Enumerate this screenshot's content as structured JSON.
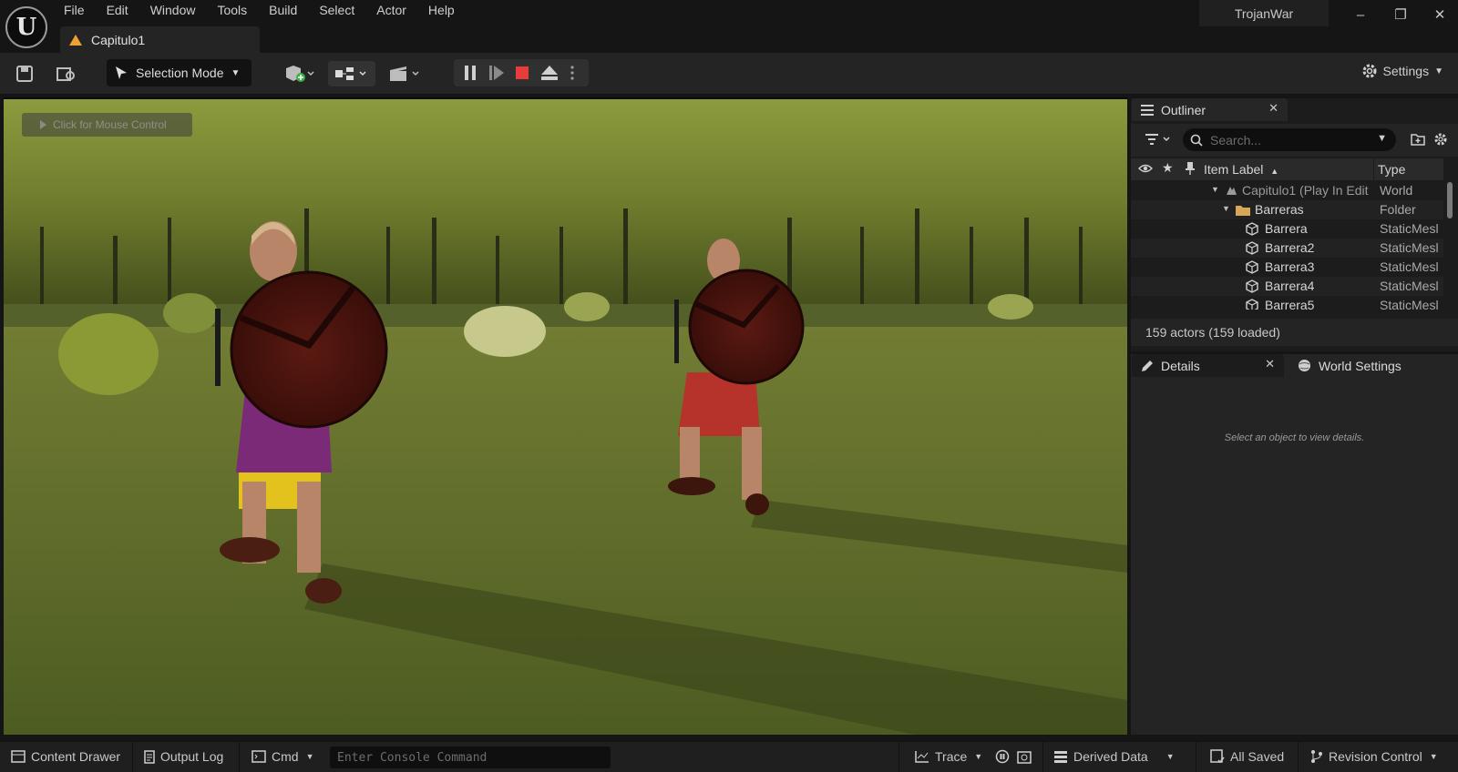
{
  "menu": [
    "File",
    "Edit",
    "Window",
    "Tools",
    "Build",
    "Select",
    "Actor",
    "Help"
  ],
  "document_tab": "Capitulo1",
  "project_name": "TrojanWar",
  "window_controls": {
    "minimize": "–",
    "restore": "❐",
    "close": "✕"
  },
  "toolbar": {
    "selection_mode": "Selection Mode",
    "settings": "Settings"
  },
  "viewport": {
    "mouse_control": "Click for Mouse Control"
  },
  "outliner": {
    "tab": "Outliner",
    "search_placeholder": "Search...",
    "columns": {
      "label": "Item Label",
      "type": "Type"
    },
    "rows": [
      {
        "label": "Capitulo1 (Play In Edit",
        "type": "World"
      },
      {
        "label": "Barreras",
        "type": "Folder"
      },
      {
        "label": "Barrera",
        "type": "StaticMesl"
      },
      {
        "label": "Barrera2",
        "type": "StaticMesl"
      },
      {
        "label": "Barrera3",
        "type": "StaticMesl"
      },
      {
        "label": "Barrera4",
        "type": "StaticMesl"
      },
      {
        "label": "Barrera5",
        "type": "StaticMesl"
      }
    ],
    "actor_count": "159 actors (159 loaded)"
  },
  "details": {
    "tab": "Details",
    "world_settings_tab": "World Settings",
    "empty_hint": "Select an object to view details."
  },
  "statusbar": {
    "content_drawer": "Content Drawer",
    "output_log": "Output Log",
    "cmd": "Cmd",
    "console_placeholder": "Enter Console Command",
    "trace": "Trace",
    "derived_data": "Derived Data",
    "all_saved": "All Saved",
    "revision_control": "Revision Control"
  },
  "colors": {
    "background": "#151515",
    "panel": "#242424",
    "stop_red": "#e83c3c",
    "warning_orange": "#f0a030"
  }
}
